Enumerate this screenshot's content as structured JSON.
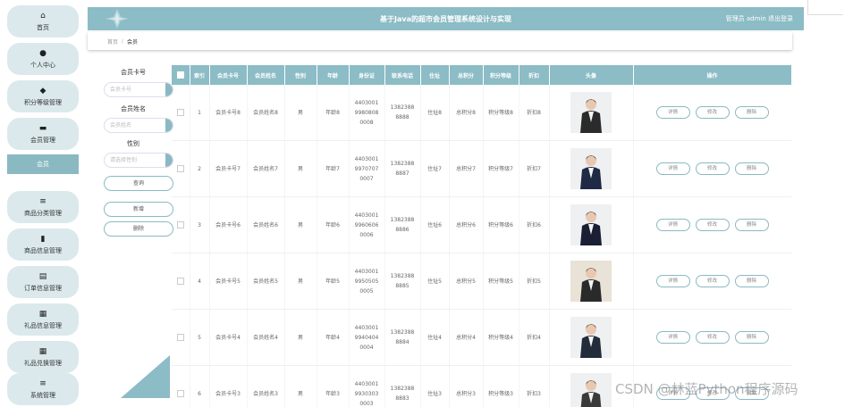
{
  "header": {
    "title": "基于Java的超市会员管理系统设计与实现",
    "user": "管理员 admin  退出登录"
  },
  "breadcrumb": {
    "home": "首页",
    "sep": "/",
    "current": "会员"
  },
  "sidebar": {
    "items": [
      {
        "label": "首页",
        "icon": "⌂"
      },
      {
        "label": "个人中心",
        "icon": "●"
      },
      {
        "label": "积分等级管理",
        "icon": "◆"
      },
      {
        "label": "会员管理",
        "icon": "▬"
      },
      {
        "label": "商品分类管理",
        "icon": "≡"
      },
      {
        "label": "商品信息管理",
        "icon": "▮"
      },
      {
        "label": "订单信息管理",
        "icon": "▤"
      },
      {
        "label": "礼品信息管理",
        "icon": "▦"
      },
      {
        "label": "礼品兑换管理",
        "icon": "▦"
      },
      {
        "label": "系统管理",
        "icon": "≡"
      }
    ],
    "active_sub": "会员"
  },
  "search": {
    "card_label": "会员卡号",
    "card_placeholder": "会员卡号",
    "name_label": "会员姓名",
    "name_placeholder": "会员姓名",
    "gender_label": "性别",
    "gender_placeholder": "请选择性别",
    "query_btn": "查询",
    "add_btn": "新增",
    "delete_btn": "删除"
  },
  "table": {
    "columns": [
      "",
      "索引",
      "会员卡号",
      "会员姓名",
      "性别",
      "年龄",
      "身份证",
      "联系电话",
      "住址",
      "总积分",
      "积分等级",
      "折扣",
      "头像",
      "操作"
    ],
    "op_labels": {
      "detail": "详情",
      "edit": "修改",
      "delete": "删除"
    },
    "rows": [
      {
        "index": "1",
        "card": "会员卡号8",
        "name": "会员姓名8",
        "gender": "男",
        "age": "年龄8",
        "id1": "4403001",
        "id2": "9980808",
        "id3": "0008",
        "phone1": "1382388",
        "phone2": "8888",
        "addr": "住址8",
        "points": "总积分8",
        "level": "积分等级8",
        "discount": "折扣8"
      },
      {
        "index": "2",
        "card": "会员卡号7",
        "name": "会员姓名7",
        "gender": "男",
        "age": "年龄7",
        "id1": "4403001",
        "id2": "9970707",
        "id3": "0007",
        "phone1": "1382388",
        "phone2": "8887",
        "addr": "住址7",
        "points": "总积分7",
        "level": "积分等级7",
        "discount": "折扣7"
      },
      {
        "index": "3",
        "card": "会员卡号6",
        "name": "会员姓名6",
        "gender": "男",
        "age": "年龄6",
        "id1": "4403001",
        "id2": "9960606",
        "id3": "0006",
        "phone1": "1382388",
        "phone2": "8886",
        "addr": "住址6",
        "points": "总积分6",
        "level": "积分等级6",
        "discount": "折扣6"
      },
      {
        "index": "4",
        "card": "会员卡号5",
        "name": "会员姓名5",
        "gender": "男",
        "age": "年龄5",
        "id1": "4403001",
        "id2": "9950505",
        "id3": "0005",
        "phone1": "1382388",
        "phone2": "8885",
        "addr": "住址5",
        "points": "总积分5",
        "level": "积分等级5",
        "discount": "折扣5"
      },
      {
        "index": "5",
        "card": "会员卡号4",
        "name": "会员姓名4",
        "gender": "男",
        "age": "年龄4",
        "id1": "4403001",
        "id2": "9940404",
        "id3": "0004",
        "phone1": "1382388",
        "phone2": "8884",
        "addr": "住址4",
        "points": "总积分4",
        "level": "积分等级4",
        "discount": "折扣4"
      },
      {
        "index": "6",
        "card": "会员卡号3",
        "name": "会员姓名3",
        "gender": "男",
        "age": "年龄3",
        "id1": "4403001",
        "id2": "9930303",
        "id3": "0003",
        "phone1": "1382388",
        "phone2": "8883",
        "addr": "住址3",
        "points": "总积分3",
        "level": "积分等级3",
        "discount": "折扣3"
      }
    ]
  },
  "watermark": "CSDN @林蓝Python程序源码",
  "colors": {
    "accent": "#8cbcc6",
    "sidebar_item": "#dbe9ec"
  }
}
